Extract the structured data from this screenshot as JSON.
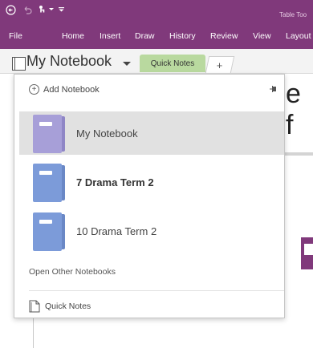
{
  "titlebar": {
    "context_tools": "Table Too"
  },
  "ribbon": {
    "tabs": [
      "File",
      "Home",
      "Insert",
      "Draw",
      "History",
      "Review",
      "View",
      "Layout"
    ]
  },
  "notebook_bar": {
    "current_notebook": "My Notebook",
    "section_tab": "Quick Notes",
    "add_section": "+"
  },
  "page": {
    "partial_text": "e f"
  },
  "dropdown": {
    "add_notebook": "Add Notebook",
    "notebooks": [
      {
        "name": "My Notebook",
        "color": "#a79fd8",
        "selected": true
      },
      {
        "name": "7 Drama Term 2",
        "color": "#7c9bd9",
        "bold": true
      },
      {
        "name": "10 Drama Term 2",
        "color": "#7c9bd9"
      }
    ],
    "open_other": "Open Other Notebooks",
    "quick_notes": "Quick Notes"
  },
  "colors": {
    "accent": "#80397b",
    "section_tab": "#b9d99f",
    "notebook_purple": "#a79fd8",
    "notebook_blue": "#7c9bd9",
    "selected_row": "#e1e1e1"
  }
}
